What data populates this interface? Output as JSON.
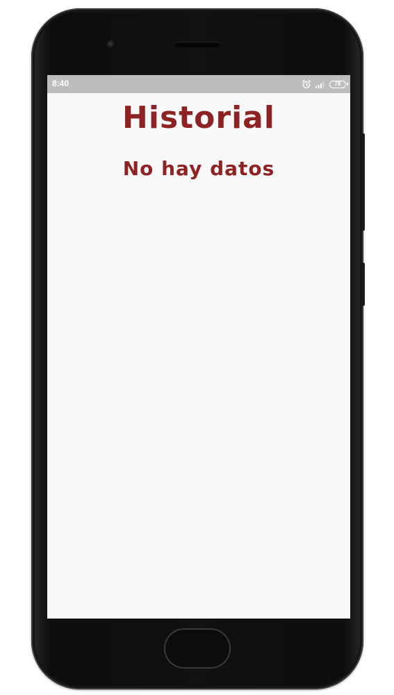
{
  "status_bar": {
    "time": "8:40",
    "battery": "78",
    "icons": [
      "alarm-icon",
      "signal-icon",
      "battery-icon"
    ]
  },
  "main": {
    "title": "Historial",
    "empty_message": "No hay datos"
  },
  "colors": {
    "accent": "#8e2323",
    "status_bar": "#bdbdbd",
    "screen_background": "#f9f9f9",
    "device": "#111111"
  }
}
